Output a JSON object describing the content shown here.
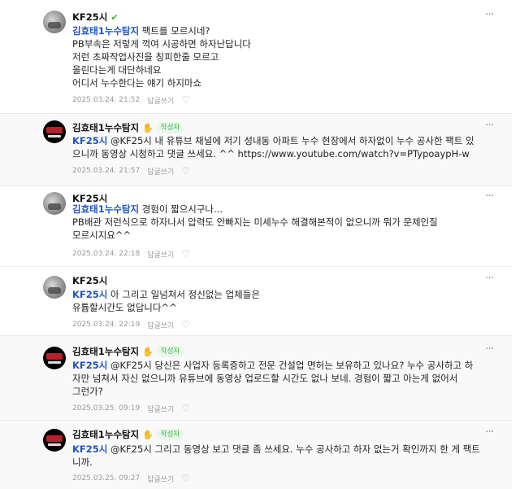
{
  "comments": [
    {
      "nickname": "KF25시",
      "badge": "✔",
      "mention": "김효태1누수탐지",
      "lines": [
        "팩트를 모르시네?",
        "PB부속은 저렇게 꺽여 시공하면 하자난답니다",
        "저런 초짜작업사진을 칭피한줄 모르고",
        "올린다는게 대단하네요",
        "어디서 누수한다는 얘기 하지마쇼"
      ],
      "date": "2025.03.24. 21:52",
      "reply_label": "답글쓰기",
      "more": "···"
    },
    {
      "nickname": "김효태1누수탐지",
      "badge": "✋",
      "writer_label": "작성자",
      "mention": "KF25시",
      "lines": [
        "@KF25시 내 유튜브 채널에 저기 성내동 아파트 누수 현장에서 하자없이 누수 공사한 팩트 있",
        "으니까 동영상 시청하고 댓글 쓰세요. ^^ https://www.youtube.com/watch?v=PTypoaypH-w"
      ],
      "date": "2025.03.24. 21:57",
      "reply_label": "답글쓰기",
      "more": "···"
    },
    {
      "nickname": "KF25시",
      "mention": "김효태1누수탐지",
      "lines": [
        "경험이 짧으시구나...",
        "PB배관 저런식으로 하자나서 압력도 안빠지는 미세누수 해결해본적이 없으니까 뭐가 문제인질",
        "모르시지요^^"
      ],
      "date": "2025.03.24. 22:18",
      "reply_label": "답글쓰기",
      "more": "···"
    },
    {
      "nickname": "KF25시",
      "mention": "KF25시",
      "lines": [
        "아 그리고 일넘쳐서 정신없는 업체들은",
        "유튭할시간도 없답니다^^"
      ],
      "date": "2025.03.24. 22:19",
      "reply_label": "답글쓰기",
      "more": "···"
    },
    {
      "nickname": "김효태1누수탐지",
      "badge": "✋",
      "writer_label": "작성자",
      "mention": "KF25시",
      "lines": [
        "@KF25시 당신은 사업자 등록증하고 전문 건설업 면허는 보유하고 있나요? 누수 공사하고 하",
        "자만 넘쳐서 자신 없으니까 유튜브에 동영상 업로드할 시간도 없나 보네. 경험이 짧고 아는게 없어서",
        "그런가?"
      ],
      "date": "2025.03.25. 09:19",
      "reply_label": "답글쓰기",
      "more": "···"
    },
    {
      "nickname": "김효태1누수탐지",
      "badge": "✋",
      "writer_label": "작성자",
      "mention": "KF25시",
      "lines": [
        "@KF25시 그리고 동영상 보고 댓글 좀 쓰세요. 누수 공사하고 하자 없는거 확인까지 한 게 팩트",
        "니까."
      ],
      "date": "2025.03.25. 09:27",
      "reply_label": "답글쓰기",
      "more": "···"
    }
  ]
}
